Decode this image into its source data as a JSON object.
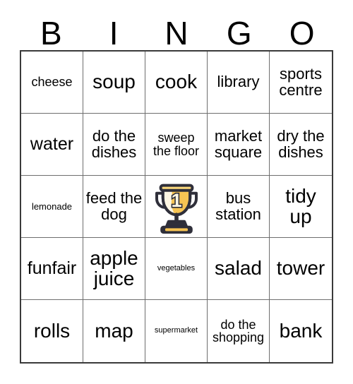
{
  "header": {
    "letters": [
      "B",
      "I",
      "N",
      "G",
      "O"
    ]
  },
  "colors": {
    "background": "#ffffff",
    "text": "#000000",
    "grid_outer_border": "#3a3a3a",
    "grid_inner_line": "#6e6e6e",
    "trophy_gold": "#f7c453",
    "trophy_gold_light": "#fbd97d",
    "trophy_cream": "#fdf6e3",
    "trophy_outline": "#2f2f3a",
    "trophy_base": "#2f2f3a"
  },
  "grid": {
    "rows": 5,
    "columns": 5,
    "cells": [
      [
        {
          "text": "cheese",
          "size": "sm"
        },
        {
          "text": "soup",
          "size": "xl"
        },
        {
          "text": "cook",
          "size": "xl"
        },
        {
          "text": "library",
          "size": "md"
        },
        {
          "text": "sports centre",
          "size": "md"
        }
      ],
      [
        {
          "text": "water",
          "size": "lg"
        },
        {
          "text": "do the dishes",
          "size": "md"
        },
        {
          "text": "sweep the floor",
          "size": "sm"
        },
        {
          "text": "market square",
          "size": "md"
        },
        {
          "text": "dry the dishes",
          "size": "md"
        }
      ],
      [
        {
          "text": "lemonade",
          "size": "xs"
        },
        {
          "text": "feed the dog",
          "size": "md"
        },
        {
          "text": "",
          "size": "md",
          "icon": "trophy-icon",
          "free_space": true,
          "icon_label": "1"
        },
        {
          "text": "bus station",
          "size": "md"
        },
        {
          "text": "tidy up",
          "size": "xl"
        }
      ],
      [
        {
          "text": "funfair",
          "size": "lg"
        },
        {
          "text": "apple juice",
          "size": "xl"
        },
        {
          "text": "vegetables",
          "size": "xxs"
        },
        {
          "text": "salad",
          "size": "xl"
        },
        {
          "text": "tower",
          "size": "xl"
        }
      ],
      [
        {
          "text": "rolls",
          "size": "xl"
        },
        {
          "text": "map",
          "size": "xl"
        },
        {
          "text": "supermarket",
          "size": "xxs"
        },
        {
          "text": "do the shopping",
          "size": "sm"
        },
        {
          "text": "bank",
          "size": "xl"
        }
      ]
    ]
  }
}
